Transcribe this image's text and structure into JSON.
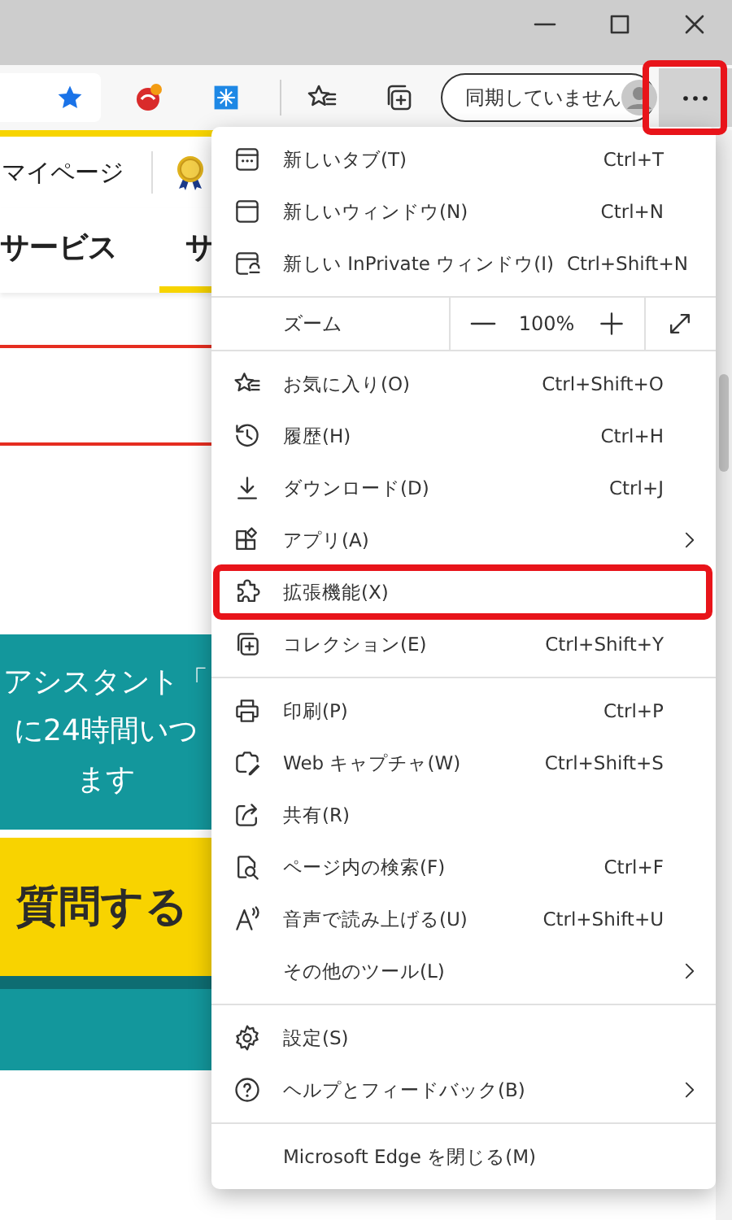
{
  "toolbar": {
    "sync_button": {
      "label": "同期していません"
    },
    "more_button": {
      "highlighted": true
    }
  },
  "page": {
    "header": {
      "link": "マイページ"
    },
    "nav": [
      {
        "label": "サービス",
        "selected": false
      },
      {
        "label": "サ",
        "selected": true
      }
    ],
    "banner": {
      "lines": [
        "アシスタント「",
        "に24時間いつ",
        "ます"
      ]
    },
    "cta": {
      "label": "質問する"
    }
  },
  "menu": {
    "sections": [
      [
        {
          "kind": "item",
          "label": "新しいタブ(T)",
          "shortcut": "Ctrl+T",
          "submenu": false,
          "highlighted": false
        },
        {
          "kind": "item",
          "label": "新しいウィンドウ(N)",
          "shortcut": "Ctrl+N",
          "submenu": false,
          "highlighted": false
        },
        {
          "kind": "item",
          "label": "新しい InPrivate ウィンドウ(I)",
          "shortcut": "Ctrl+Shift+N",
          "submenu": false,
          "highlighted": false
        }
      ],
      [
        {
          "kind": "zoom",
          "label": "ズーム",
          "value": "100%"
        }
      ],
      [
        {
          "kind": "item",
          "label": "お気に入り(O)",
          "shortcut": "Ctrl+Shift+O",
          "submenu": false,
          "highlighted": false
        },
        {
          "kind": "item",
          "label": "履歴(H)",
          "shortcut": "Ctrl+H",
          "submenu": false,
          "highlighted": false
        },
        {
          "kind": "item",
          "label": "ダウンロード(D)",
          "shortcut": "Ctrl+J",
          "submenu": false,
          "highlighted": false
        },
        {
          "kind": "item",
          "label": "アプリ(A)",
          "submenu": true,
          "highlighted": false
        },
        {
          "kind": "item",
          "label": "拡張機能(X)",
          "submenu": false,
          "highlighted": true
        },
        {
          "kind": "item",
          "label": "コレクション(E)",
          "shortcut": "Ctrl+Shift+Y",
          "submenu": false,
          "highlighted": false
        }
      ],
      [
        {
          "kind": "item",
          "label": "印刷(P)",
          "shortcut": "Ctrl+P",
          "submenu": false,
          "highlighted": false
        },
        {
          "kind": "item",
          "label": "Web キャプチャ(W)",
          "shortcut": "Ctrl+Shift+S",
          "submenu": false,
          "highlighted": false
        },
        {
          "kind": "item",
          "label": "共有(R)",
          "submenu": false,
          "highlighted": false
        },
        {
          "kind": "item",
          "label": "ページ内の検索(F)",
          "shortcut": "Ctrl+F",
          "submenu": false,
          "highlighted": false
        },
        {
          "kind": "item",
          "label": "音声で読み上げる(U)",
          "shortcut": "Ctrl+Shift+U",
          "submenu": false,
          "highlighted": false
        },
        {
          "kind": "item",
          "label": "その他のツール(L)",
          "submenu": true,
          "highlighted": false
        }
      ],
      [
        {
          "kind": "item",
          "label": "設定(S)",
          "submenu": false,
          "highlighted": false
        },
        {
          "kind": "item",
          "label": "ヘルプとフィードバック(B)",
          "submenu": true,
          "highlighted": false
        }
      ],
      [
        {
          "kind": "item",
          "label": "Microsoft Edge を閉じる(M)",
          "submenu": false,
          "highlighted": false
        }
      ]
    ]
  }
}
